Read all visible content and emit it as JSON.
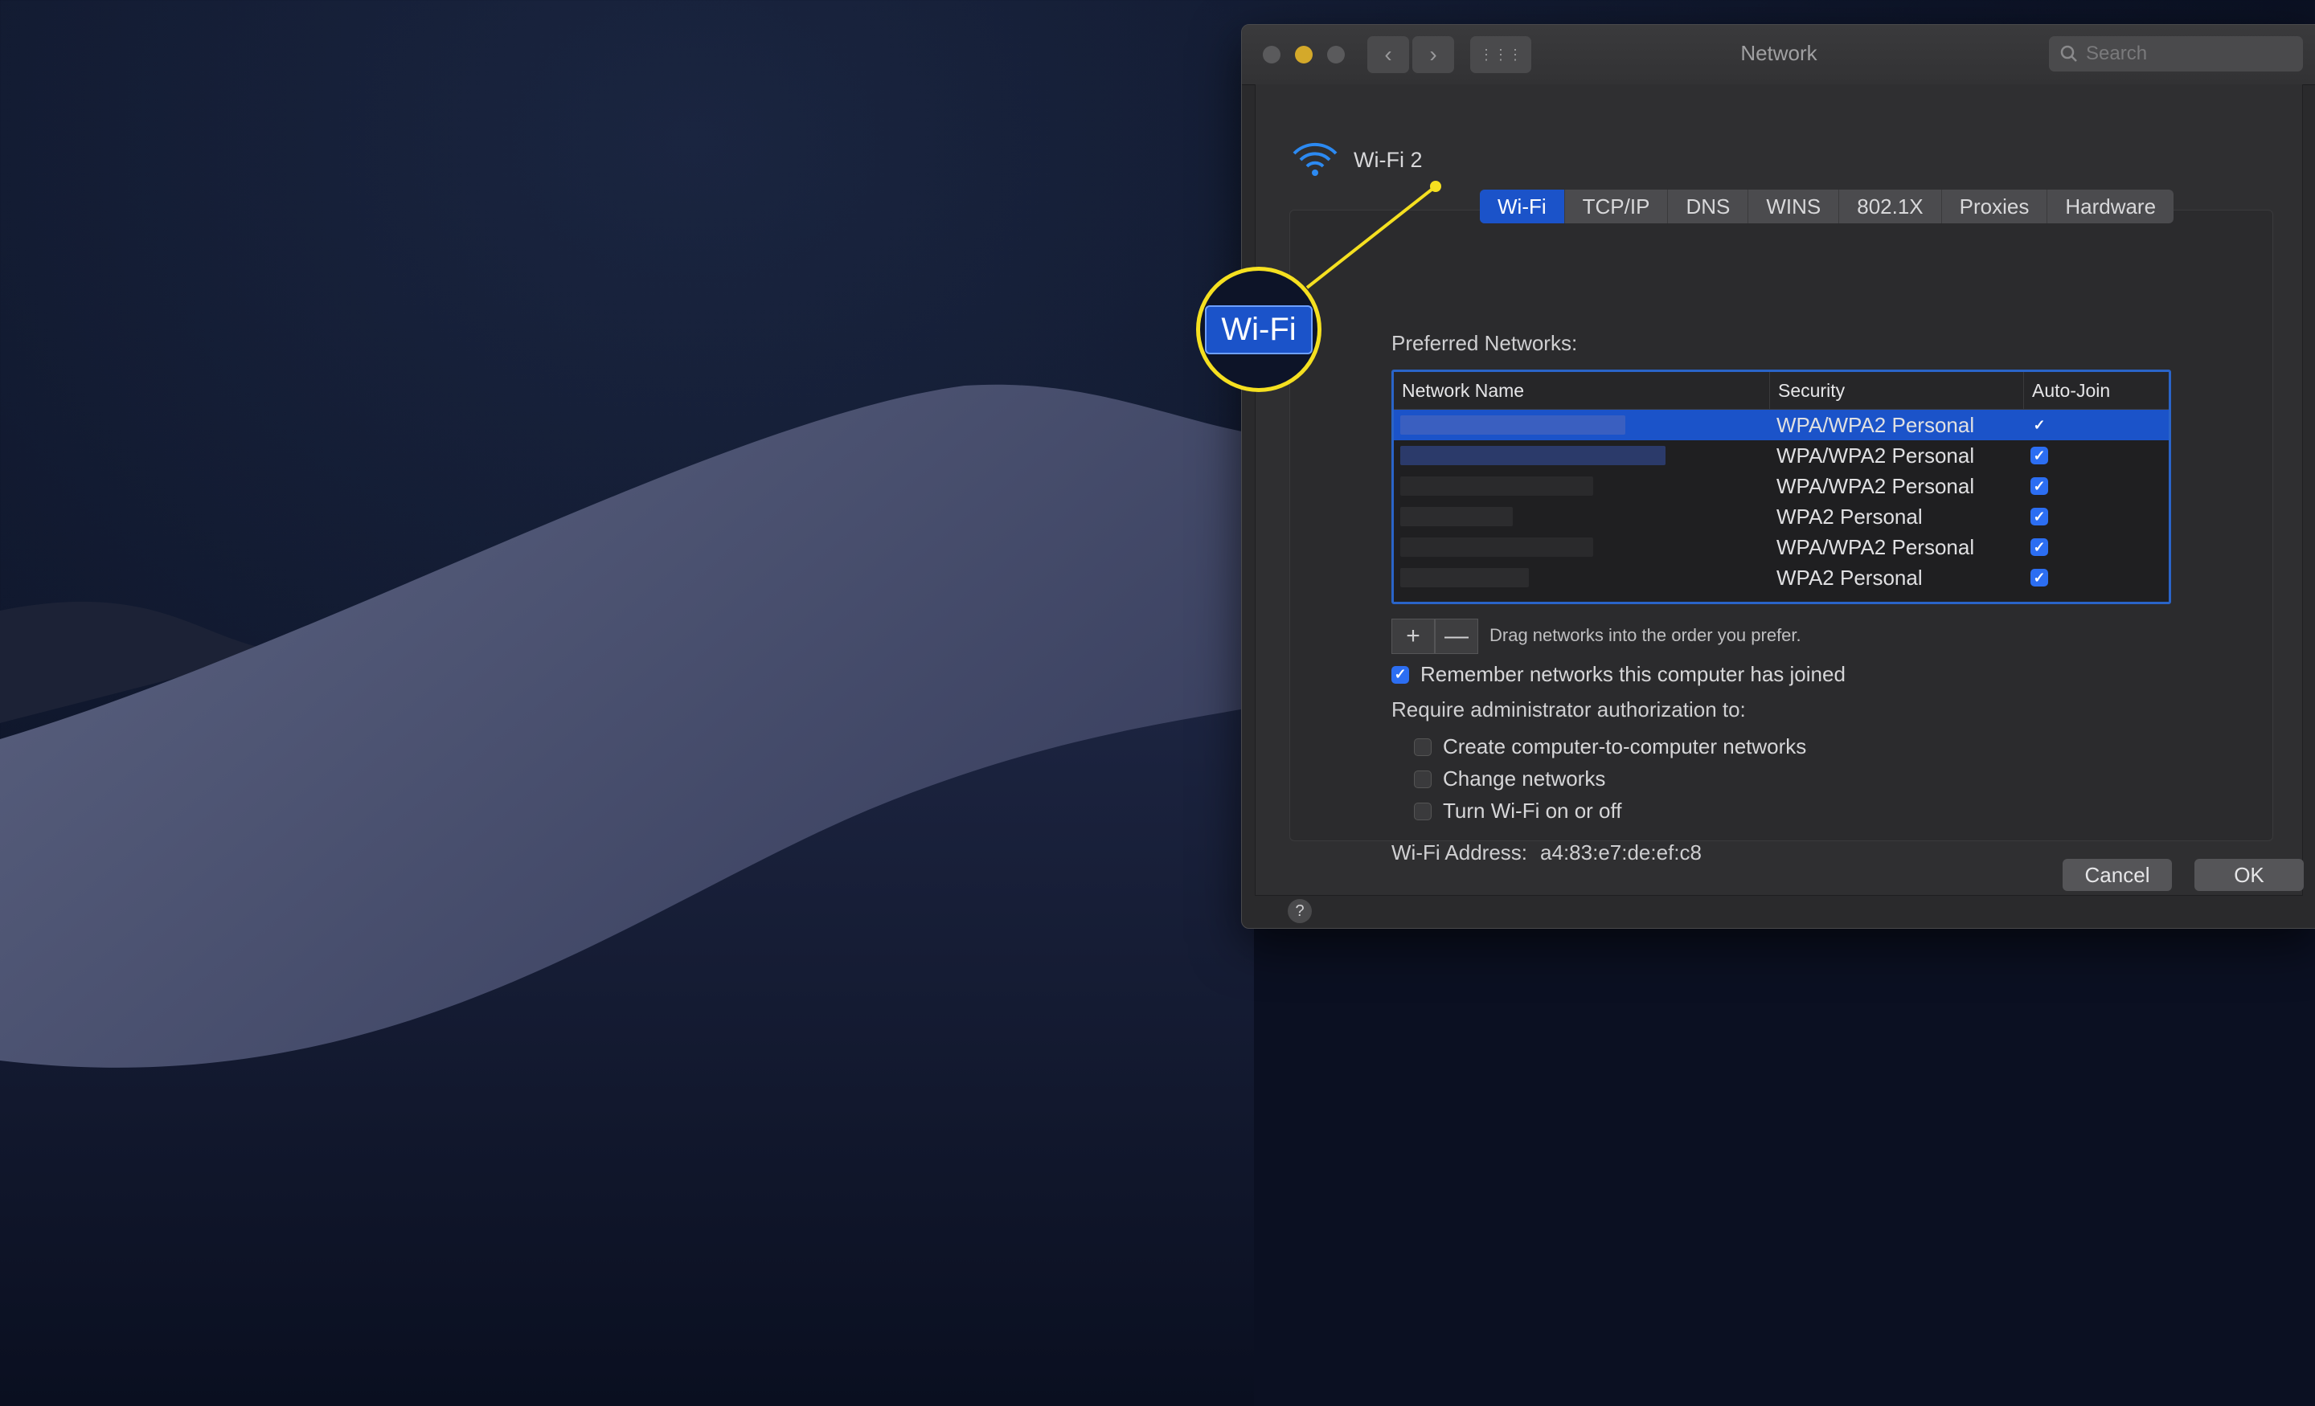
{
  "window": {
    "title": "Network",
    "search_placeholder": "Search",
    "back_glyph": "‹",
    "forward_glyph": "›",
    "grid_glyph": "⋮⋮⋮"
  },
  "interface": {
    "name": "Wi-Fi 2",
    "icon": "wifi-icon"
  },
  "tabs": [
    {
      "label": "Wi-Fi",
      "active": true
    },
    {
      "label": "TCP/IP"
    },
    {
      "label": "DNS"
    },
    {
      "label": "WINS"
    },
    {
      "label": "802.1X"
    },
    {
      "label": "Proxies"
    },
    {
      "label": "Hardware"
    }
  ],
  "preferred_networks": {
    "label": "Preferred Networks:",
    "columns": [
      "Network Name",
      "Security",
      "Auto-Join"
    ],
    "rows": [
      {
        "name": "",
        "security": "WPA/WPA2 Personal",
        "auto_join": true,
        "selected": true
      },
      {
        "name": "",
        "security": "WPA/WPA2 Personal",
        "auto_join": true
      },
      {
        "name": "",
        "security": "WPA/WPA2 Personal",
        "auto_join": true
      },
      {
        "name": "",
        "security": "WPA2 Personal",
        "auto_join": true
      },
      {
        "name": "",
        "security": "WPA/WPA2 Personal",
        "auto_join": true
      },
      {
        "name": "",
        "security": "WPA2 Personal",
        "auto_join": true
      }
    ],
    "add_label": "+",
    "remove_label": "—",
    "hint": "Drag networks into the order you prefer."
  },
  "options": {
    "remember": {
      "label": "Remember networks this computer has joined",
      "checked": true
    },
    "require_label": "Require administrator authorization to:",
    "create": {
      "label": "Create computer-to-computer networks",
      "checked": false
    },
    "change": {
      "label": "Change networks",
      "checked": false
    },
    "toggle": {
      "label": "Turn Wi-Fi on or off",
      "checked": false
    }
  },
  "address": {
    "label": "Wi-Fi Address:",
    "value": "a4:83:e7:de:ef:c8"
  },
  "buttons": {
    "help": "?",
    "cancel": "Cancel",
    "ok": "OK"
  },
  "callout": {
    "label": "Wi-Fi",
    "color": "#f5e020"
  },
  "colors": {
    "accent": "#1b53c9",
    "checkbox": "#2c6ef2"
  }
}
